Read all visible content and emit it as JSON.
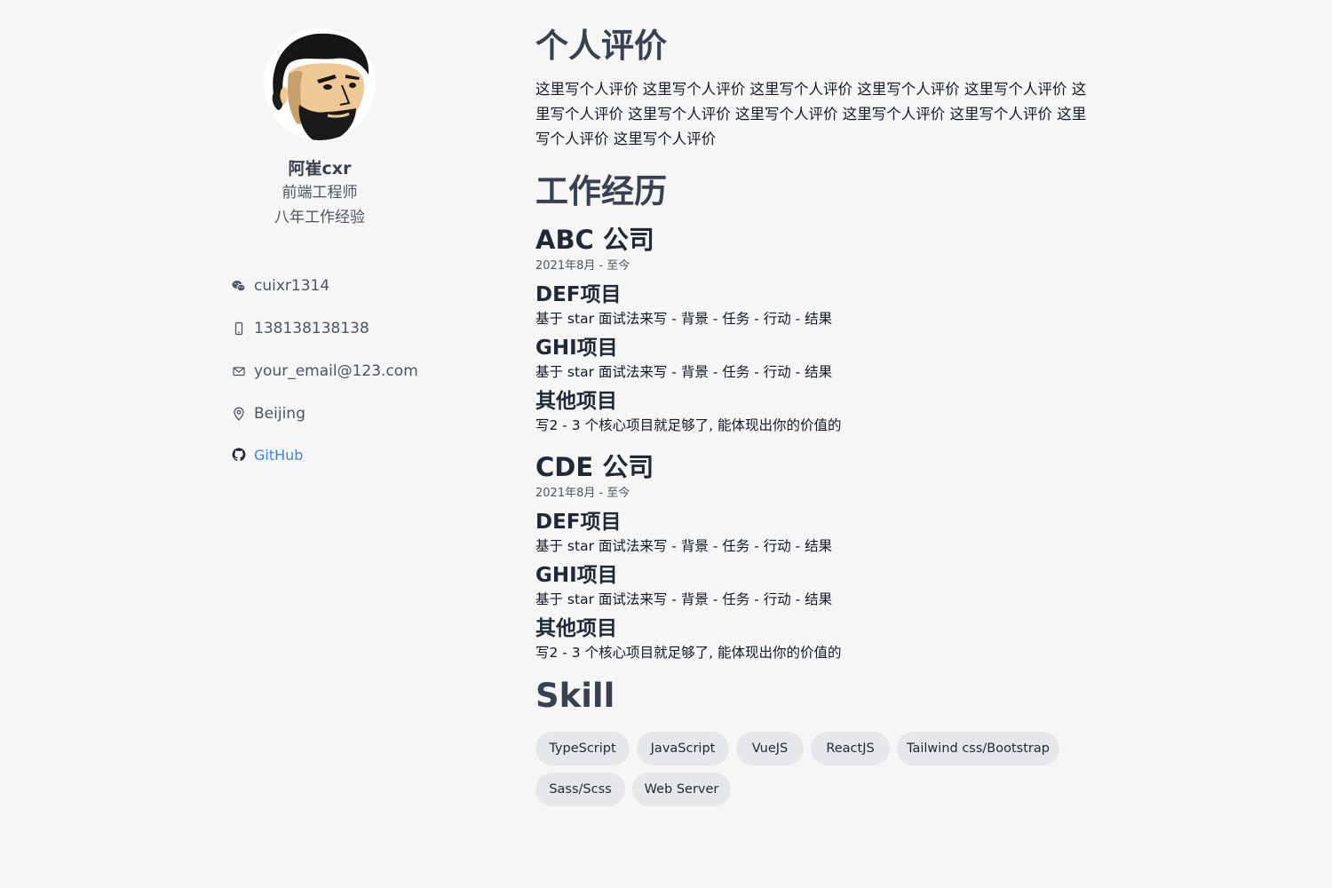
{
  "profile": {
    "name": "阿崔cxr",
    "role": "前端工程师",
    "experience": "八年工作经验"
  },
  "contacts": {
    "wechat": "cuixr1314",
    "phone": "138138138138",
    "email": "your_email@123.com",
    "location": "Beijing",
    "github": "GitHub"
  },
  "icons": {
    "wechat": "wechat-icon",
    "phone": "phone-icon",
    "email": "mail-icon",
    "location": "map-pin-icon",
    "github": "github-icon"
  },
  "colors": {
    "background": "#f6f6f6",
    "heading": "#374151",
    "link": "#3b82f6",
    "chip": "#e5e7eb"
  },
  "summary": {
    "heading": "个人评价",
    "text": "这里写个人评价 这里写个人评价 这里写个人评价 这里写个人评价 这里写个人评价 这里写个人评价 这里写个人评价 这里写个人评价 这里写个人评价 这里写个人评价 这里写个人评价 这里写个人评价"
  },
  "experience": {
    "heading": "工作经历",
    "companies": [
      {
        "name": "ABC 公司",
        "period": "2021年8月 - 至今",
        "projects": [
          {
            "title": "DEF项目",
            "desc": "基于 star 面试法来写 - 背景 - 任务 - 行动 - 结果"
          },
          {
            "title": "GHI项目",
            "desc": "基于 star 面试法来写 - 背景 - 任务 - 行动 - 结果"
          },
          {
            "title": "其他项目",
            "desc": "写2 - 3 个核心项目就足够了, 能体现出你的价值的"
          }
        ]
      },
      {
        "name": "CDE 公司",
        "period": "2021年8月 - 至今",
        "projects": [
          {
            "title": "DEF项目",
            "desc": "基于 star 面试法来写 - 背景 - 任务 - 行动 - 结果"
          },
          {
            "title": "GHI项目",
            "desc": "基于 star 面试法来写 - 背景 - 任务 - 行动 - 结果"
          },
          {
            "title": "其他项目",
            "desc": "写2 - 3 个核心项目就足够了, 能体现出你的价值的"
          }
        ]
      }
    ]
  },
  "skills": {
    "heading": "Skill",
    "items": [
      "TypeScript",
      "JavaScript",
      "VueJS",
      "ReactJS",
      "Tailwind css/Bootstrap",
      "Sass/Scss",
      "Web Server"
    ]
  }
}
